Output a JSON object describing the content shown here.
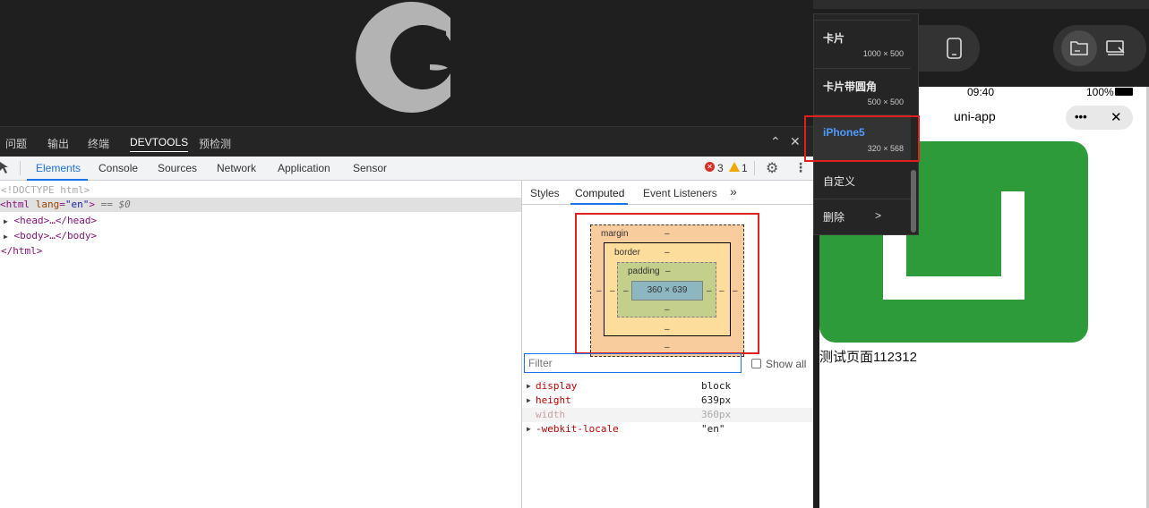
{
  "panel_tabs": [
    "问题",
    "输出",
    "终端",
    "DEVTOOLS",
    "预检测"
  ],
  "panel_controls": {
    "collapse": "⌃",
    "close": "✕"
  },
  "devtools_tabs": [
    "Elements",
    "Console",
    "Sources",
    "Network",
    "Application",
    "Sensor"
  ],
  "issues": {
    "errors": "3",
    "warnings": "1"
  },
  "elements_tree": {
    "doctype": "<!DOCTYPE html>",
    "html_open_tag": "html",
    "html_attr_name": "lang",
    "html_attr_value": "\"en\"",
    "selected_marker": "== $0",
    "head": "<head>…</head>",
    "body": "<body>…</body>",
    "html_close": "</html>"
  },
  "side_tabs": [
    "Styles",
    "Computed",
    "Event Listeners",
    "»"
  ],
  "box_model": {
    "margin_label": "margin",
    "border_label": "border",
    "padding_label": "padding",
    "content": "360 × 639",
    "dash": "–"
  },
  "filter": {
    "placeholder": "Filter",
    "show_all_label": "Show all"
  },
  "computed_props": [
    {
      "name": "display",
      "value": "block"
    },
    {
      "name": "height",
      "value": "639px"
    },
    {
      "name": "width",
      "value": "360px"
    },
    {
      "name": "-webkit-locale",
      "value": "\"en\""
    }
  ],
  "device_menu": [
    {
      "name": "卡片",
      "size": "1000 × 500"
    },
    {
      "name": "卡片带圆角",
      "size": "500 × 500"
    },
    {
      "name": "iPhone5",
      "size": "320 × 568"
    },
    {
      "name": "自定义",
      "size": ""
    },
    {
      "name": "删除",
      "size": ">"
    }
  ],
  "phone": {
    "time": "09:40",
    "battery": "100%",
    "nav_title": "uni-app",
    "capsule_more": "•••",
    "capsule_close": "✕",
    "page_text": "测试页面112312"
  },
  "colors": {
    "accent": "#1a73e8",
    "highlight": "#e0201c",
    "card_green": "#2e9b3b"
  }
}
